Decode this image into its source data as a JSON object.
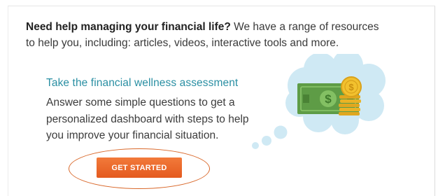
{
  "intro": {
    "bold": "Need help managing your financial life?",
    "rest": " We have a range of resources to help you, including: articles, videos, interactive tools and more."
  },
  "assessment": {
    "title": "Take the financial wellness assessment",
    "description": "Answer some simple questions to get a personalized dashboard with steps to help you improve your financial situation.",
    "cta_label": "GET STARTED"
  },
  "illustration": {
    "icon": "money-thought-bubble-icon"
  },
  "colors": {
    "title_accent": "#2a8fa3",
    "cta": "#ea6a2a",
    "highlight_ellipse": "#d9682a",
    "bubble": "#cfe9f4",
    "bill": "#6aa84f",
    "coin": "#f2c12e"
  }
}
